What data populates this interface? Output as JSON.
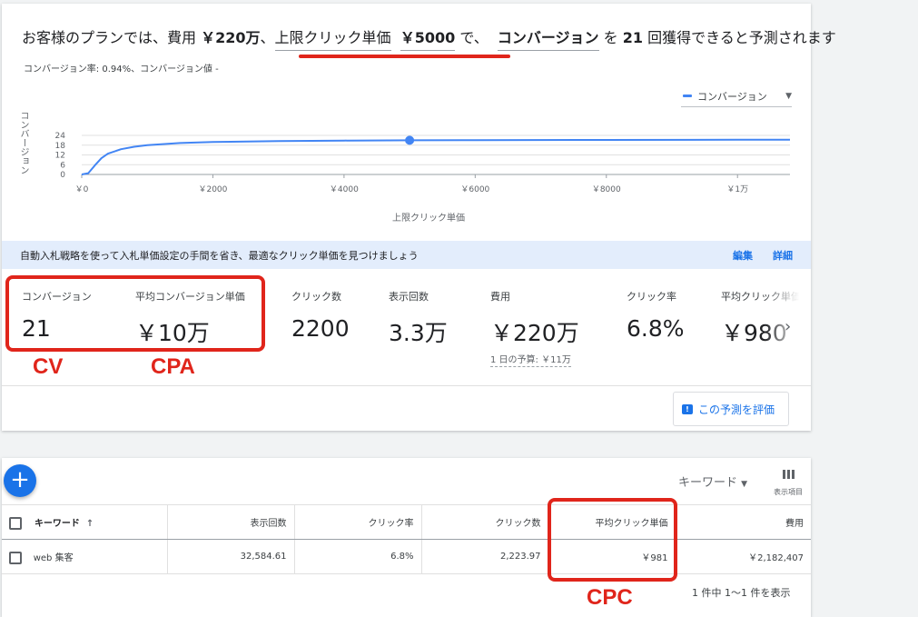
{
  "headline": {
    "prefix": "お客様のプランでは、費用 ",
    "cost": "￥220万",
    "sep1": "、",
    "max_cpc_label": "上限クリック単価",
    "max_cpc_value": "￥5000",
    "mid": " で、",
    "metric": "コンバージョン",
    "suffix_a": " を ",
    "count": "21",
    "suffix_b": " 回獲得できると予測されます"
  },
  "rate_line": "コンバージョン率: 0.94%、コンバージョン値 -",
  "legend": {
    "label": "コンバージョン"
  },
  "chart_data": {
    "type": "line",
    "xlabel": "上限クリック単価",
    "ylabel": "コンバージョン",
    "x_ticks": [
      "￥0",
      "￥2000",
      "￥4000",
      "￥6000",
      "￥8000",
      "￥1万"
    ],
    "y_ticks": [
      "0",
      "6",
      "12",
      "18",
      "24"
    ],
    "xlim": [
      0,
      10800
    ],
    "ylim": [
      0,
      24
    ],
    "series": [
      {
        "name": "コンバージョン",
        "x": [
          0,
          100,
          200,
          300,
          400,
          600,
          800,
          1000,
          1500,
          2000,
          3000,
          4000,
          5000,
          6000,
          8000,
          10000,
          10800
        ],
        "y": [
          0,
          0.8,
          5.5,
          10,
          12.8,
          15.5,
          17,
          18,
          19.3,
          19.9,
          20.5,
          20.8,
          21,
          21.1,
          21.2,
          21.3,
          21.4
        ]
      }
    ],
    "highlight": {
      "x": 5000,
      "y": 21
    },
    "grid": true
  },
  "banner": {
    "text": "自動入札戦略を使って入札単価設定の手間を省き、最適なクリック単価を見つけましょう",
    "edit": "編集",
    "details": "詳細"
  },
  "metrics": [
    {
      "label": "コンバージョン",
      "value": "21"
    },
    {
      "label": "平均コンバージョン単価",
      "value": "￥10万"
    },
    {
      "label": "クリック数",
      "value": "2200"
    },
    {
      "label": "表示回数",
      "value": "3.3万"
    },
    {
      "label": "費用",
      "value": "￥220万"
    },
    {
      "label": "クリック率",
      "value": "6.8%"
    },
    {
      "label": "平均クリック単価",
      "value": "￥980"
    }
  ],
  "daily_budget": "1 日の予算: ￥11万",
  "annotations": {
    "cv": "CV",
    "cpa": "CPA",
    "cpc": "CPC"
  },
  "evaluate_button": "この予測を評価",
  "table": {
    "keyword_dropdown": "キーワード",
    "columns_button": "表示項目",
    "headers": [
      "キーワード",
      "表示回数",
      "クリック率",
      "クリック数",
      "平均クリック単価",
      "費用"
    ],
    "sort_indicator": "↑",
    "rows": [
      {
        "keyword": "web 集客",
        "impressions": "32,584.61",
        "ctr": "6.8%",
        "clicks": "2,223.97",
        "avg_cpc": "￥981",
        "cost": "￥2,182,407"
      }
    ],
    "pagination": "1 件中 1〜1 件を表示"
  },
  "colors": {
    "accent": "#1a73e8",
    "line": "#4285f4",
    "annotation": "#e0251b",
    "banner": "#e3edfc"
  }
}
